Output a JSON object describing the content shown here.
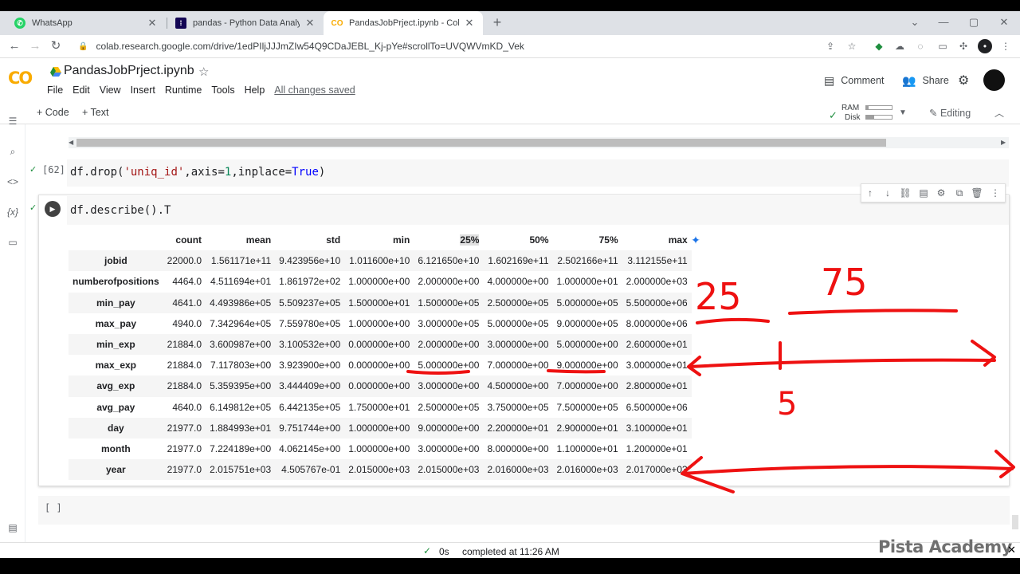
{
  "browser": {
    "tabs": [
      {
        "label": "WhatsApp",
        "icon": "whatsapp-icon",
        "color": "#25d366",
        "active": false
      },
      {
        "label": "pandas - Python Data Analysis Li",
        "icon": "pandas-icon",
        "color": "#130654",
        "active": false
      },
      {
        "label": "PandasJobPrject.ipynb - Colabor",
        "icon": "colab-icon",
        "color": "#f9ab00",
        "active": true
      }
    ],
    "url": "colab.research.google.com/drive/1edPIljJJJmZIw54Q9CDaJEBL_Kj-pYe#scrollTo=UVQWVmKD_Vek"
  },
  "notebook": {
    "title": "PandasJobPrject.ipynb",
    "menu": [
      "File",
      "Edit",
      "View",
      "Insert",
      "Runtime",
      "Tools",
      "Help"
    ],
    "save_status": "All changes saved",
    "comment_label": "Comment",
    "share_label": "Share",
    "code_label": "+ Code",
    "text_label": "+ Text",
    "ram_label": "RAM",
    "disk_label": "Disk",
    "ram_usage": 0.1,
    "disk_usage": 0.3,
    "editing_label": "Editing"
  },
  "cells": {
    "prev": {
      "exec_count": "[62]",
      "code": [
        "df",
        ".drop(",
        "'uniq_id'",
        ",axis=",
        "1",
        ",inplace=",
        "True",
        ")"
      ]
    },
    "active": {
      "code": "df.describe().T"
    },
    "empty_prompt": "[ ]"
  },
  "output": {
    "columns": [
      "count",
      "mean",
      "std",
      "min",
      "25%",
      "50%",
      "75%",
      "max"
    ],
    "rows": [
      {
        "index": "jobid",
        "values": [
          "22000.0",
          "1.561171e+11",
          "9.423956e+10",
          "1.011600e+10",
          "6.121650e+10",
          "1.602169e+11",
          "2.502166e+11",
          "3.112155e+11"
        ]
      },
      {
        "index": "numberofpositions",
        "values": [
          "4464.0",
          "4.511694e+01",
          "1.861972e+02",
          "1.000000e+00",
          "2.000000e+00",
          "4.000000e+00",
          "1.000000e+01",
          "2.000000e+03"
        ]
      },
      {
        "index": "min_pay",
        "values": [
          "4641.0",
          "4.493986e+05",
          "5.509237e+05",
          "1.500000e+01",
          "1.500000e+05",
          "2.500000e+05",
          "5.000000e+05",
          "5.500000e+06"
        ]
      },
      {
        "index": "max_pay",
        "values": [
          "4940.0",
          "7.342964e+05",
          "7.559780e+05",
          "1.000000e+00",
          "3.000000e+05",
          "5.000000e+05",
          "9.000000e+05",
          "8.000000e+06"
        ]
      },
      {
        "index": "min_exp",
        "values": [
          "21884.0",
          "3.600987e+00",
          "3.100532e+00",
          "0.000000e+00",
          "2.000000e+00",
          "3.000000e+00",
          "5.000000e+00",
          "2.600000e+01"
        ]
      },
      {
        "index": "max_exp",
        "values": [
          "21884.0",
          "7.117803e+00",
          "3.923900e+00",
          "0.000000e+00",
          "5.000000e+00",
          "7.000000e+00",
          "9.000000e+00",
          "3.000000e+01"
        ]
      },
      {
        "index": "avg_exp",
        "values": [
          "21884.0",
          "5.359395e+00",
          "3.444409e+00",
          "0.000000e+00",
          "3.000000e+00",
          "4.500000e+00",
          "7.000000e+00",
          "2.800000e+01"
        ]
      },
      {
        "index": "avg_pay",
        "values": [
          "4640.0",
          "6.149812e+05",
          "6.442135e+05",
          "1.750000e+01",
          "2.500000e+05",
          "3.750000e+05",
          "7.500000e+05",
          "6.500000e+06"
        ]
      },
      {
        "index": "day",
        "values": [
          "21977.0",
          "1.884993e+01",
          "9.751744e+00",
          "1.000000e+00",
          "9.000000e+00",
          "2.200000e+01",
          "2.900000e+01",
          "3.100000e+01"
        ]
      },
      {
        "index": "month",
        "values": [
          "21977.0",
          "7.224189e+00",
          "4.062145e+00",
          "1.000000e+00",
          "3.000000e+00",
          "8.000000e+00",
          "1.100000e+01",
          "1.200000e+01"
        ]
      },
      {
        "index": "year",
        "values": [
          "21977.0",
          "2.015751e+03",
          "4.505767e-01",
          "2.015000e+03",
          "2.015000e+03",
          "2.016000e+03",
          "2.016000e+03",
          "2.017000e+03"
        ]
      }
    ]
  },
  "annotations": {
    "label_25": "25",
    "label_75": "75",
    "label_5": "5"
  },
  "status": {
    "elapsed": "0s",
    "text": "completed at 11:26 AM"
  },
  "watermark": "Pista Academy"
}
